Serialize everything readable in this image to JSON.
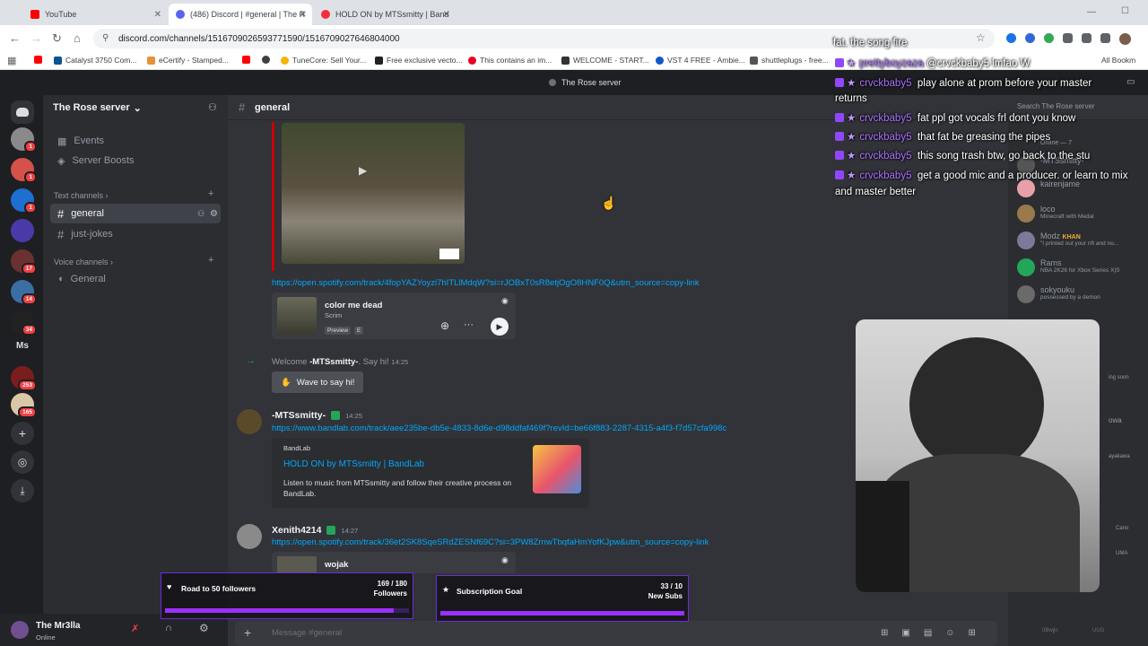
{
  "browser": {
    "tabs": [
      {
        "label": "YouTube",
        "color": "#ff0000"
      },
      {
        "label": "(486) Discord | #general | The R",
        "color": "#5865f2"
      },
      {
        "label": "HOLD ON by MTSsmitty | Band",
        "color": "#f22e3e"
      }
    ],
    "url": "discord.com/channels/1516709026593771590/1516709027646804000",
    "bookmarks": [
      "Catalyst 3750 Com...",
      "eCertify - Stamped...",
      "TuneCore: Sell Your...",
      "Free exclusive vecto...",
      "This contains an im...",
      "WELCOME - START...",
      "VST 4 FREE - Ambie...",
      "shuttleplugs - free..."
    ],
    "all_bookmarks": "All Bookm"
  },
  "discord": {
    "window_title": "The Rose server",
    "server_name": "The Rose server",
    "rail_badges": [
      "1",
      "1",
      "1",
      "17",
      "14",
      "34",
      "253",
      "165"
    ],
    "rail_text": "Ms",
    "sidebar": {
      "events": "Events",
      "boosts": "Server Boosts",
      "text_category": "Text channels",
      "text_channels": [
        "general",
        "just-jokes"
      ],
      "voice_category": "Voice channels",
      "voice_channels": [
        "General"
      ]
    },
    "channel_header": "general",
    "search_placeholder": "Search The Rose server",
    "user": {
      "name": "The Mr3lla",
      "status": "Online"
    },
    "message_placeholder": "Message #general",
    "messages": {
      "spotify_link_1": "https://open.spotify.com/track/4fopYAZYoyzi7hITLlMdqW?si=rJOBxT0sR8etjOgO8HNF0Q&utm_source=copy-link",
      "spotify_card_1": {
        "title": "color me dead",
        "artist": "Scrim",
        "preview": "Preview",
        "explicit": "E"
      },
      "welcome": {
        "prefix": "Welcome",
        "name": "-MTSsmitty-",
        "suffix": ". Say hi!",
        "time": "14:25",
        "wave_button": "Wave to say hi!"
      },
      "mts_message": {
        "author": "-MTSsmitty-",
        "time": "14:25",
        "link": "https://www.bandlab.com/track/aee235be-db5e-4833-8d6e-d98ddfaf469f?revId=be66f883-2287-4315-a4f3-f7d57cfa998c"
      },
      "bandlab_embed": {
        "provider": "BandLab",
        "title": "HOLD ON by MTSsmitty | BandLab",
        "description": "Listen to music from MTSsmitty and follow their creative process on BandLab."
      },
      "xen_message": {
        "author": "Xenith4214",
        "time": "14:27",
        "link": "https://open.spotify.com/track/36et2SK8SqeSRdZESNf69C?si=3PW8ZrnwTbqfaHmYofKJpw&utm_source=copy-link"
      },
      "spotify_card_2": {
        "title": "wojak"
      }
    },
    "members": [
      {
        "name": "-MTSsmitty-",
        "sub": ""
      },
      {
        "name": "kairenjame",
        "sub": ""
      },
      {
        "name": "loco",
        "sub": "Minecraft with Medal"
      },
      {
        "name": "Modz",
        "tag": "KHAN",
        "sub": "\"I printed out your nft and no..."
      },
      {
        "name": "Rams",
        "sub": "NBA 2K26 for Xbox Series X|S"
      },
      {
        "name": "sokyouku",
        "sub": "possessed by a demon"
      }
    ],
    "member_fragments": [
      "Online — 7",
      "ing soon",
      "owa",
      "ayakawa",
      "Cano",
      "UMA",
      "0Bwjjn",
      "UUG"
    ]
  },
  "stream_overlay": {
    "chat": [
      {
        "name": "",
        "text": "fat. the song fire"
      },
      {
        "name": "prettyboyzaza",
        "text": "@crvckbaby5 lmfao W"
      },
      {
        "name": "crvckbaby5",
        "text": "play alone at prom before your master returns"
      },
      {
        "name": "crvckbaby5",
        "text": "fat ppl got vocals frl dont you know"
      },
      {
        "name": "crvckbaby5",
        "text": "that fat be greasing the pipes"
      },
      {
        "name": "crvckbaby5",
        "text": "this song trash btw, go back to the stu"
      },
      {
        "name": "crvckbaby5",
        "text": "get a good mic and a producer. or learn to mix and master better"
      }
    ],
    "goals": [
      {
        "title": "Road to 50 followers",
        "current": "169 / 180",
        "unit": "Followers",
        "progress": 0.939
      },
      {
        "title": "Subscription Goal",
        "current": "33 / 10",
        "unit": "New Subs",
        "progress": 1.0
      }
    ]
  },
  "colors": {
    "accent": "#5865f2",
    "link": "#00a8fc",
    "twitch": "#9146ff",
    "online": "#23a55a"
  }
}
